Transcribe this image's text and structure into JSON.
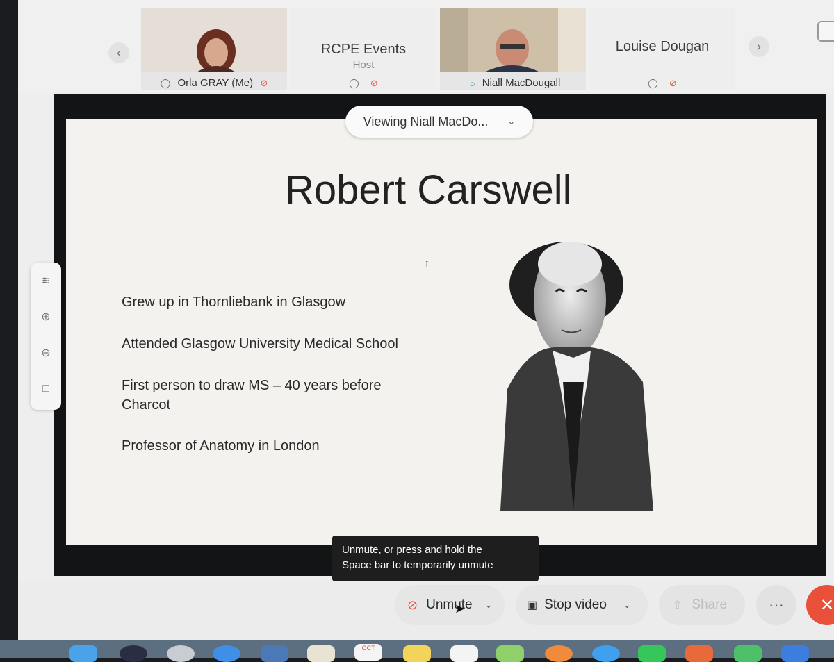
{
  "participants": [
    {
      "name": "Orla GRAY  (Me)",
      "has_video": true,
      "muted": true
    },
    {
      "name": "RCPE Events",
      "role": "Host",
      "has_video": false,
      "muted": true
    },
    {
      "name": "Niall MacDougall",
      "has_video": true,
      "muted": false,
      "speaking": true
    },
    {
      "name": "Louise Dougan",
      "has_video": false,
      "muted": true
    }
  ],
  "viewing_label": "Viewing Niall MacDo...",
  "slide": {
    "title": "Robert Carswell",
    "bullets": [
      "Grew up in Thornliebank in Glasgow",
      "Attended Glasgow University Medical School",
      "First person to draw MS – 40 years before Charcot",
      "Professor of Anatomy in London"
    ],
    "cursor_glyph": "I"
  },
  "tooltip": {
    "line1": "Unmute, or press and hold the",
    "line2": "Space bar to temporarily unmute"
  },
  "controls": {
    "unmute_label": "Unmute",
    "stop_video_label": "Stop video",
    "share_label": "Share",
    "more_label": "···",
    "leave_label": "✕"
  },
  "dock": {
    "calendar_month": "OCT"
  },
  "colors": {
    "accent_red": "#e8503a",
    "stage_bg": "#131416",
    "tooltip_bg": "#1e1e1e"
  }
}
